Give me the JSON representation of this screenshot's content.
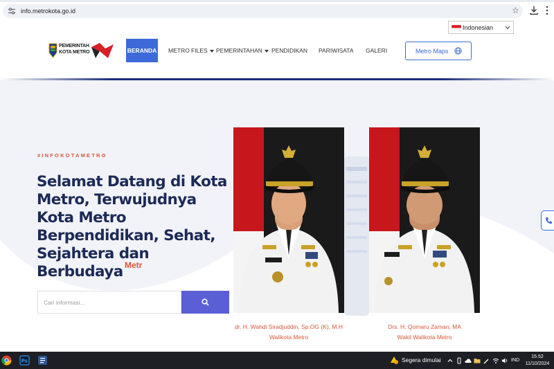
{
  "browser": {
    "url": "info.metrokota.go.id",
    "icons": [
      "site-info-icon",
      "star-icon",
      "download-icon",
      "menu-icon"
    ]
  },
  "header": {
    "language": {
      "selected": "Indonesian"
    },
    "logo": {
      "line1": "PEMERINTAH",
      "line2": "KOTA METRO"
    },
    "nav": [
      {
        "label": "BERANDA",
        "active": true
      },
      {
        "label": "METRO FILES",
        "dropdown": true
      },
      {
        "label": "PEMERINTAHAN",
        "dropdown": true
      },
      {
        "label": "PENDIDIKAN"
      },
      {
        "label": "PARIWISATA"
      },
      {
        "label": "GALERI"
      }
    ],
    "maps_button": "Metro Maps"
  },
  "hero": {
    "hashtag": "#INFOKOTAMETRO",
    "headline": "Selamat Datang di Kota Metro, Terwujudnya Kota Metro Berpendidikan, Sehat, Sejahtera dan Berbudaya",
    "typed_text": "Metr",
    "search": {
      "placeholder": "Cari informasi...",
      "value": ""
    },
    "officials": [
      {
        "name": "dr. H. Wahdi Siradjuddin, Sp.OG (K), M.H",
        "role": "Walikota Metro",
        "nametag": "WAHDI"
      },
      {
        "name": "Drs. H. Qomaru Zaman, MA",
        "role": "Wakil Walikota Metro",
        "nametag": "QOMARU"
      }
    ]
  },
  "colors": {
    "accent_blue": "#3e6ad9",
    "accent_orange": "#d8553a",
    "headline_navy": "#1c2a57",
    "search_button": "#5b5fd6"
  },
  "taskbar": {
    "weather": "Segera dimulai",
    "input_language": "IND",
    "time": "15.52",
    "date": "11/10/2024"
  }
}
